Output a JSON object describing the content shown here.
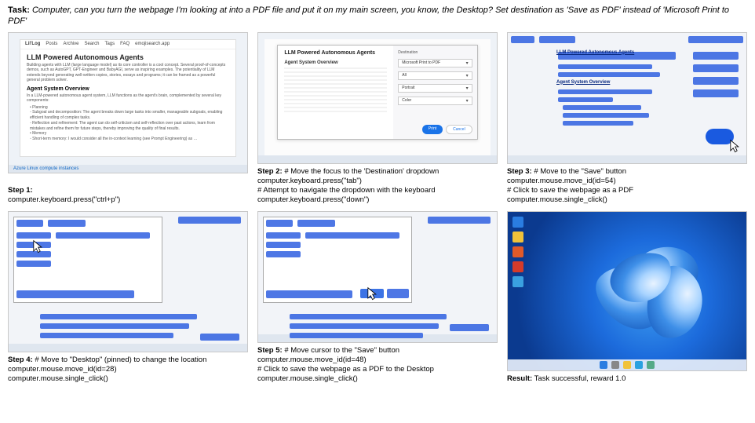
{
  "task": {
    "label": "Task:",
    "text": "Computer, can you turn the webpage I'm looking at into a PDF file and put it on my main screen, you know, the Desktop? Set destination as 'Save as PDF' instead of 'Microsoft Print to PDF'"
  },
  "steps": [
    {
      "label": "Step 1:",
      "lines": [
        "computer.keyboard.press(\"ctrl+p\")"
      ],
      "blog": {
        "nav": [
          "Lil'Log",
          "Posts",
          "Archive",
          "Search",
          "Tags",
          "FAQ",
          "emojisearch.app"
        ],
        "title": "LLM Powered Autonomous Agents",
        "para1": "Building agents with LLM (large language model) as its core controller is a cool concept. Several proof-of-concepts demos, such as AutoGPT, GPT-Engineer and BabyAGI, serve as inspiring examples. The potentiality of LLM extends beyond generating well-written copies, stories, essays and programs; it can be framed as a powerful general problem solver.",
        "section": "Agent System Overview",
        "para2": "In a LLM-powered autonomous agent system, LLM functions as the agent's brain, complemented by several key components:",
        "bullets_h1": "• Planning",
        "bullets": [
          "  ◦ Subgoal and decomposition: The agent breaks down large tasks into smaller, manageable subgoals, enabling efficient handling of complex tasks.",
          "  ◦ Reflection and refinement: The agent can do self-criticism and self-reflection over past actions, learn from mistakes and refine them for future steps, thereby improving the quality of final results."
        ],
        "bullets_h2": "• Memory",
        "memline": "  ◦ Short-term memory: I would consider all the in-context learning (see Prompt Engineering) as …",
        "azure": "Azure Linux compute instances"
      }
    },
    {
      "label": "Step 2:",
      "lines": [
        "# Move the focus to the 'Destination' dropdown",
        "computer.keyboard.press(\"tab\")",
        "# Attempt to navigate the dropdown with the keyboard",
        "computer.keyboard.press(\"down\")"
      ],
      "dialog": {
        "title": "LLM Powered Autonomous Agents",
        "section": "Agent System Overview",
        "dest_label": "Destination",
        "dest_value": "Microsoft Print to PDF",
        "pages_value": "All",
        "layout_value": "Portrait",
        "color_value": "Color",
        "print_btn": "Print",
        "cancel_btn": "Cancel"
      }
    },
    {
      "label": "Step 3:",
      "lines": [
        "# Move to the \"Save\" button",
        "computer.mouse.move_id(id=54)",
        "# Click to save the webpage as a PDF",
        "computer.mouse.single_click()"
      ],
      "annot_title": "LLM Powered Autonomous Agents",
      "annot_section": "Agent System Overview"
    },
    {
      "label": "Step 4:",
      "lines": [
        "# Move to \"Desktop\" (pinned) to change the location",
        "computer.mouse.move_id(id=28)",
        "computer.mouse.single_click()"
      ]
    },
    {
      "label": "Step 5:",
      "lines": [
        "# Move cursor to the \"Save\" button",
        "computer.mouse.move_id(id=48)",
        "# Click to save the webpage as a PDF to the Desktop",
        "computer.mouse.single_click()"
      ]
    },
    {
      "label": "Result:",
      "lines": [
        "Task successful, reward 1.0"
      ]
    }
  ],
  "colors": {
    "accent": "#1a73e8",
    "annot_blue": "#2f5fe0"
  }
}
